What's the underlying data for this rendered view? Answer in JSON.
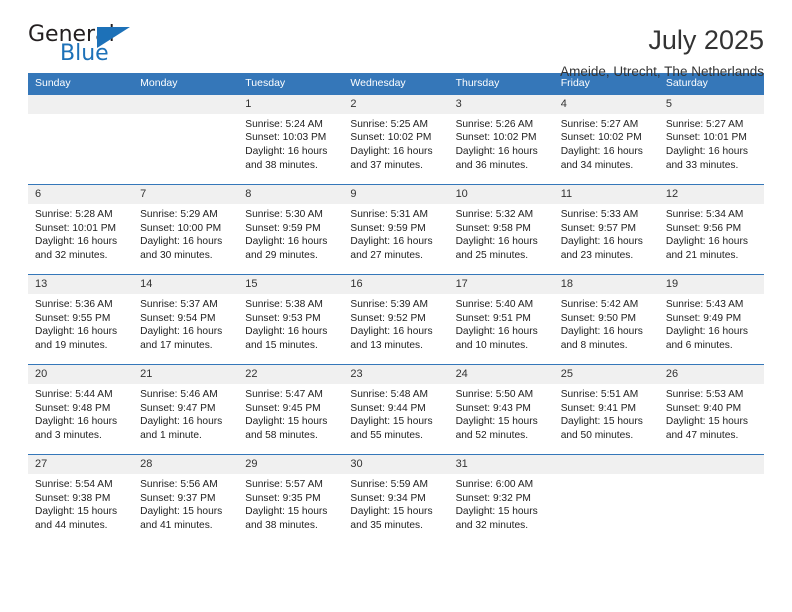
{
  "logo": {
    "word_top": "General",
    "word_bottom": "Blue",
    "triangle_color": "#1d71b8"
  },
  "header": {
    "title": "July 2025",
    "subtitle": "Ameide, Utrecht, The Netherlands"
  },
  "colors": {
    "header_blue": "#3577b9",
    "daynum_gray": "#f0f0f0",
    "text": "#222222"
  },
  "weekday_headers": [
    "Sunday",
    "Monday",
    "Tuesday",
    "Wednesday",
    "Thursday",
    "Friday",
    "Saturday"
  ],
  "weeks": [
    [
      {
        "day": "",
        "blank": true
      },
      {
        "day": "",
        "blank": true
      },
      {
        "day": "1",
        "sunrise": "Sunrise: 5:24 AM",
        "sunset": "Sunset: 10:03 PM",
        "daylight": "Daylight: 16 hours and 38 minutes."
      },
      {
        "day": "2",
        "sunrise": "Sunrise: 5:25 AM",
        "sunset": "Sunset: 10:02 PM",
        "daylight": "Daylight: 16 hours and 37 minutes."
      },
      {
        "day": "3",
        "sunrise": "Sunrise: 5:26 AM",
        "sunset": "Sunset: 10:02 PM",
        "daylight": "Daylight: 16 hours and 36 minutes."
      },
      {
        "day": "4",
        "sunrise": "Sunrise: 5:27 AM",
        "sunset": "Sunset: 10:02 PM",
        "daylight": "Daylight: 16 hours and 34 minutes."
      },
      {
        "day": "5",
        "sunrise": "Sunrise: 5:27 AM",
        "sunset": "Sunset: 10:01 PM",
        "daylight": "Daylight: 16 hours and 33 minutes."
      }
    ],
    [
      {
        "day": "6",
        "sunrise": "Sunrise: 5:28 AM",
        "sunset": "Sunset: 10:01 PM",
        "daylight": "Daylight: 16 hours and 32 minutes."
      },
      {
        "day": "7",
        "sunrise": "Sunrise: 5:29 AM",
        "sunset": "Sunset: 10:00 PM",
        "daylight": "Daylight: 16 hours and 30 minutes."
      },
      {
        "day": "8",
        "sunrise": "Sunrise: 5:30 AM",
        "sunset": "Sunset: 9:59 PM",
        "daylight": "Daylight: 16 hours and 29 minutes."
      },
      {
        "day": "9",
        "sunrise": "Sunrise: 5:31 AM",
        "sunset": "Sunset: 9:59 PM",
        "daylight": "Daylight: 16 hours and 27 minutes."
      },
      {
        "day": "10",
        "sunrise": "Sunrise: 5:32 AM",
        "sunset": "Sunset: 9:58 PM",
        "daylight": "Daylight: 16 hours and 25 minutes."
      },
      {
        "day": "11",
        "sunrise": "Sunrise: 5:33 AM",
        "sunset": "Sunset: 9:57 PM",
        "daylight": "Daylight: 16 hours and 23 minutes."
      },
      {
        "day": "12",
        "sunrise": "Sunrise: 5:34 AM",
        "sunset": "Sunset: 9:56 PM",
        "daylight": "Daylight: 16 hours and 21 minutes."
      }
    ],
    [
      {
        "day": "13",
        "sunrise": "Sunrise: 5:36 AM",
        "sunset": "Sunset: 9:55 PM",
        "daylight": "Daylight: 16 hours and 19 minutes."
      },
      {
        "day": "14",
        "sunrise": "Sunrise: 5:37 AM",
        "sunset": "Sunset: 9:54 PM",
        "daylight": "Daylight: 16 hours and 17 minutes."
      },
      {
        "day": "15",
        "sunrise": "Sunrise: 5:38 AM",
        "sunset": "Sunset: 9:53 PM",
        "daylight": "Daylight: 16 hours and 15 minutes."
      },
      {
        "day": "16",
        "sunrise": "Sunrise: 5:39 AM",
        "sunset": "Sunset: 9:52 PM",
        "daylight": "Daylight: 16 hours and 13 minutes."
      },
      {
        "day": "17",
        "sunrise": "Sunrise: 5:40 AM",
        "sunset": "Sunset: 9:51 PM",
        "daylight": "Daylight: 16 hours and 10 minutes."
      },
      {
        "day": "18",
        "sunrise": "Sunrise: 5:42 AM",
        "sunset": "Sunset: 9:50 PM",
        "daylight": "Daylight: 16 hours and 8 minutes."
      },
      {
        "day": "19",
        "sunrise": "Sunrise: 5:43 AM",
        "sunset": "Sunset: 9:49 PM",
        "daylight": "Daylight: 16 hours and 6 minutes."
      }
    ],
    [
      {
        "day": "20",
        "sunrise": "Sunrise: 5:44 AM",
        "sunset": "Sunset: 9:48 PM",
        "daylight": "Daylight: 16 hours and 3 minutes."
      },
      {
        "day": "21",
        "sunrise": "Sunrise: 5:46 AM",
        "sunset": "Sunset: 9:47 PM",
        "daylight": "Daylight: 16 hours and 1 minute."
      },
      {
        "day": "22",
        "sunrise": "Sunrise: 5:47 AM",
        "sunset": "Sunset: 9:45 PM",
        "daylight": "Daylight: 15 hours and 58 minutes."
      },
      {
        "day": "23",
        "sunrise": "Sunrise: 5:48 AM",
        "sunset": "Sunset: 9:44 PM",
        "daylight": "Daylight: 15 hours and 55 minutes."
      },
      {
        "day": "24",
        "sunrise": "Sunrise: 5:50 AM",
        "sunset": "Sunset: 9:43 PM",
        "daylight": "Daylight: 15 hours and 52 minutes."
      },
      {
        "day": "25",
        "sunrise": "Sunrise: 5:51 AM",
        "sunset": "Sunset: 9:41 PM",
        "daylight": "Daylight: 15 hours and 50 minutes."
      },
      {
        "day": "26",
        "sunrise": "Sunrise: 5:53 AM",
        "sunset": "Sunset: 9:40 PM",
        "daylight": "Daylight: 15 hours and 47 minutes."
      }
    ],
    [
      {
        "day": "27",
        "sunrise": "Sunrise: 5:54 AM",
        "sunset": "Sunset: 9:38 PM",
        "daylight": "Daylight: 15 hours and 44 minutes."
      },
      {
        "day": "28",
        "sunrise": "Sunrise: 5:56 AM",
        "sunset": "Sunset: 9:37 PM",
        "daylight": "Daylight: 15 hours and 41 minutes."
      },
      {
        "day": "29",
        "sunrise": "Sunrise: 5:57 AM",
        "sunset": "Sunset: 9:35 PM",
        "daylight": "Daylight: 15 hours and 38 minutes."
      },
      {
        "day": "30",
        "sunrise": "Sunrise: 5:59 AM",
        "sunset": "Sunset: 9:34 PM",
        "daylight": "Daylight: 15 hours and 35 minutes."
      },
      {
        "day": "31",
        "sunrise": "Sunrise: 6:00 AM",
        "sunset": "Sunset: 9:32 PM",
        "daylight": "Daylight: 15 hours and 32 minutes."
      },
      {
        "day": "",
        "blank": true
      },
      {
        "day": "",
        "blank": true
      }
    ]
  ]
}
